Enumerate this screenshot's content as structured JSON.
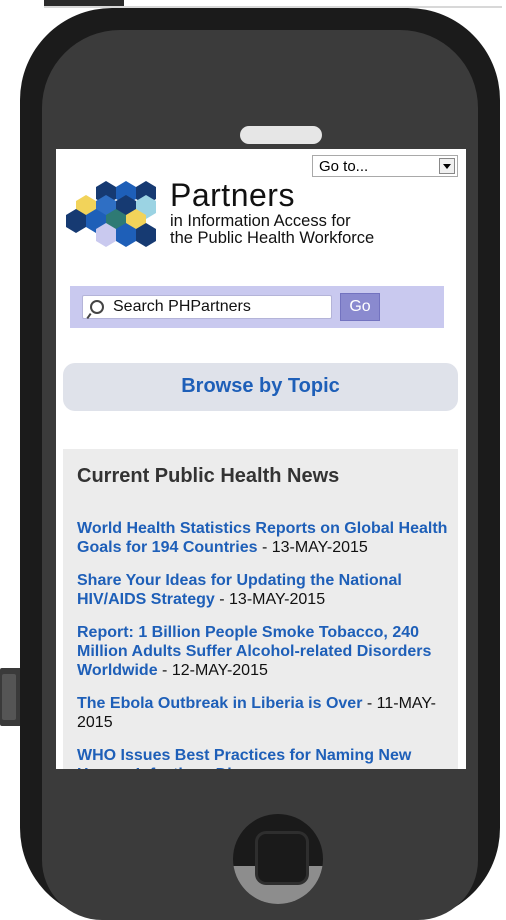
{
  "goto_select": {
    "value": "Go to..."
  },
  "logo": {
    "title": "Partners",
    "subtitle_line1": "in Information Access for",
    "subtitle_line2": "the Public Health Workforce"
  },
  "search": {
    "placeholder": "Search PHPartners",
    "go_label": "Go"
  },
  "browse_label": "Browse by Topic",
  "news": {
    "heading": "Current Public Health News",
    "items": [
      {
        "title": "World Health Statistics Reports on Global Health Goals for 194 Countries",
        "date": " - 13-MAY-2015"
      },
      {
        "title": "Share Your Ideas for Updating the National HIV/AIDS Strategy",
        "date": " - 13-MAY-2015"
      },
      {
        "title": "Report: 1 Billion People Smoke Tobacco, 240 Million Adults Suffer Alcohol-related Disorders Worldwide",
        "date": " - 12-MAY-2015"
      },
      {
        "title": "The Ebola Outbreak in Liberia is Over",
        "date": " - 11-MAY-2015"
      },
      {
        "title": "WHO Issues Best Practices for Naming New Human Infectious Diseases",
        "date": ""
      }
    ]
  },
  "colors": {
    "link": "#1e5fb8",
    "search_band": "#c9c9ef",
    "go_button": "#8a8acf",
    "browse_bg": "#dfe2ea",
    "news_bg": "#ececec",
    "phone_body": "#1b1b1b"
  }
}
